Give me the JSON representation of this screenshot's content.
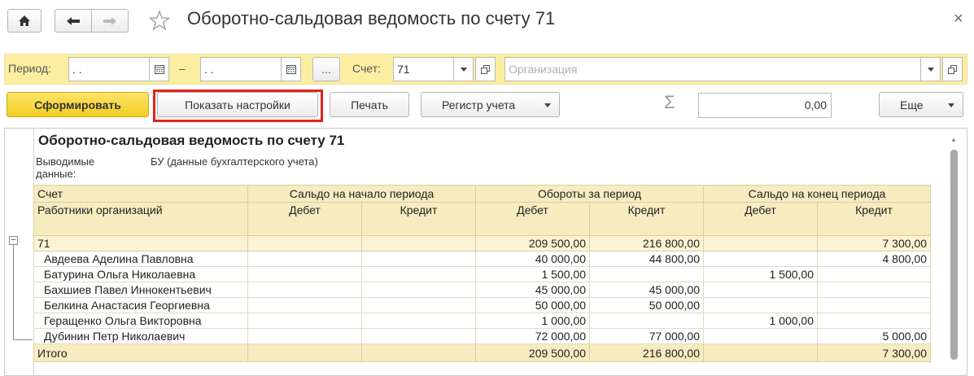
{
  "header": {
    "title": "Оборотно-сальдовая ведомость по счету 71",
    "home_icon": "home-icon",
    "back_icon": "arrow-left-icon",
    "forward_icon": "arrow-right-icon",
    "star_icon": "star-icon",
    "close_glyph": "×"
  },
  "filters": {
    "period_label": "Период:",
    "date_from": " .  .",
    "dash": "–",
    "date_to": " .  .",
    "ellipsis": "...",
    "account_label": "Счет:",
    "account_value": "71",
    "organization_placeholder": "Организация"
  },
  "toolbar": {
    "generate": "Сформировать",
    "show_settings": "Показать настройки",
    "print": "Печать",
    "register": "Регистр учета",
    "sigma": "Σ",
    "sum_value": "0,00",
    "more": "Еще"
  },
  "report": {
    "title": "Оборотно-сальдовая ведомость по счету 71",
    "output_label": "Выводимые данные:",
    "output_value": "БУ (данные бухгалтерского учета)",
    "col_account": "Счет",
    "col_subconto": "Работники организаций",
    "col_opening": "Сальдо на начало периода",
    "col_turnover": "Обороты за период",
    "col_closing": "Сальдо на конец периода",
    "debit": "Дебет",
    "credit": "Кредит",
    "group": {
      "name": "71",
      "values": [
        "",
        "",
        "209 500,00",
        "216 800,00",
        "",
        "7 300,00"
      ]
    },
    "rows": [
      {
        "name": "Авдеева Аделина Павловна",
        "values": [
          "",
          "",
          "40 000,00",
          "44 800,00",
          "",
          "4 800,00"
        ]
      },
      {
        "name": "Батурина Ольга Николаевна",
        "values": [
          "",
          "",
          "1 500,00",
          "",
          "1 500,00",
          ""
        ]
      },
      {
        "name": "Бахшиев Павел Иннокентьевич",
        "values": [
          "",
          "",
          "45 000,00",
          "45 000,00",
          "",
          ""
        ]
      },
      {
        "name": "Белкина Анастасия Георгиевна",
        "values": [
          "",
          "",
          "50 000,00",
          "50 000,00",
          "",
          ""
        ]
      },
      {
        "name": "Геращенко Ольга Викторовна",
        "values": [
          "",
          "",
          "1 000,00",
          "",
          "1 000,00",
          ""
        ]
      },
      {
        "name": "Дубинин Петр Николаевич",
        "values": [
          "",
          "",
          "72 000,00",
          "77 000,00",
          "",
          "5 000,00"
        ]
      }
    ],
    "total": {
      "name": "Итого",
      "values": [
        "",
        "",
        "209 500,00",
        "216 800,00",
        "",
        "7 300,00"
      ]
    },
    "collapse_glyph": "−"
  }
}
